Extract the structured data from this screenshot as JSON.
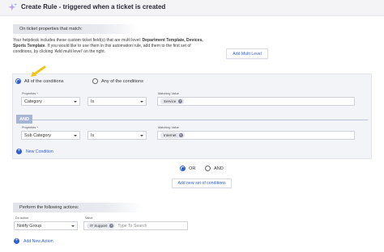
{
  "header": {
    "title": "Create Rule - triggered when a ticket is created",
    "icon": "sparkle-icon"
  },
  "conditions": {
    "section_label": "On ticket properties that match:",
    "info_prefix": "Your helpdesk includes these custom ticket field(s) that are multi level: ",
    "info_fields": "Department Template, Devices, Sports Template",
    "info_suffix": ". If you would like to use them in this automation rule, add them to the first set of conditions, by clicking 'Add multi level' on the right.",
    "add_multi_level_label": "Add Multi Level",
    "match_all_label": "All of the conditions",
    "match_any_label": "Any of the conditions",
    "match_mode": "all",
    "rows": [
      {
        "properties_label": "Properties *",
        "property": "Category",
        "operator": "Is",
        "value_label": "Matching Value",
        "values": [
          "Service"
        ]
      },
      {
        "properties_label": "Properties *",
        "property": "Sub Category",
        "operator": "Is",
        "value_label": "Matching Value",
        "values": [
          "Internet"
        ]
      }
    ],
    "and_label": "AND",
    "new_condition_label": "New Condition"
  },
  "sets": {
    "or_label": "OR",
    "and_label": "AND",
    "selected": "or",
    "add_set_label": "Add new set of conditions"
  },
  "actions": {
    "section_label": "Perform the following actions:",
    "action_label": "Do Action",
    "action_value": "Notify Group",
    "value_label": "Value",
    "chips": [
      "IT Support"
    ],
    "search_placeholder": "Type To Search",
    "add_action_label": "Add New Action"
  },
  "colors": {
    "accent": "#2f5fd0",
    "arrow": "#f0c419",
    "and_tag": "#a8b6d6"
  }
}
